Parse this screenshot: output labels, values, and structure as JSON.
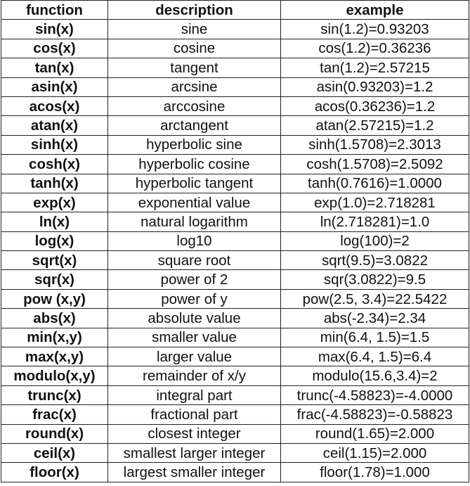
{
  "table": {
    "headers": [
      "function",
      "description",
      "example"
    ],
    "rows": [
      [
        "sin(x)",
        "sine",
        "sin(1.2)=0.93203"
      ],
      [
        "cos(x)",
        "cosine",
        "cos(1.2)=0.36236"
      ],
      [
        "tan(x)",
        "tangent",
        "tan(1.2)=2.57215"
      ],
      [
        "asin(x)",
        "arcsine",
        "asin(0.93203)=1.2"
      ],
      [
        "acos(x)",
        "arccosine",
        "acos(0.36236)=1.2"
      ],
      [
        "atan(x)",
        "arctangent",
        "atan(2.57215)=1.2"
      ],
      [
        "sinh(x)",
        "hyperbolic sine",
        "sinh(1.5708)=2.3013"
      ],
      [
        "cosh(x)",
        "hyperbolic cosine",
        "cosh(1.5708)=2.5092"
      ],
      [
        "tanh(x)",
        "hyperbolic tangent",
        "tanh(0.7616)=1.0000"
      ],
      [
        "exp(x)",
        "exponential value",
        "exp(1.0)=2.718281"
      ],
      [
        "ln(x)",
        "natural logarithm",
        "ln(2.718281)=1.0"
      ],
      [
        "log(x)",
        "log10",
        "log(100)=2"
      ],
      [
        "sqrt(x)",
        "square root",
        "sqrt(9.5)=3.0822"
      ],
      [
        "sqr(x)",
        "power of 2",
        "sqr(3.0822)=9.5"
      ],
      [
        "pow (x,y)",
        "power of y",
        "pow(2.5, 3.4)=22.5422"
      ],
      [
        "abs(x)",
        "absolute value",
        "abs(-2.34)=2.34"
      ],
      [
        "min(x,y)",
        "smaller value",
        "min(6.4, 1.5)=1.5"
      ],
      [
        "max(x,y)",
        "larger value",
        "max(6.4, 1.5)=6.4"
      ],
      [
        "modulo(x,y)",
        "remainder of x/y",
        "modulo(15.6,3.4)=2"
      ],
      [
        "trunc(x)",
        "integral part",
        "trunc(-4.58823)=-4.0000"
      ],
      [
        "frac(x)",
        "fractional part",
        "frac(-4.58823)=-0.58823"
      ],
      [
        "round(x)",
        "closest integer",
        "round(1.65)=2.000"
      ],
      [
        "ceil(x)",
        "smallest larger integer",
        "ceil(1.15)=2.000"
      ],
      [
        "floor(x)",
        "largest smaller integer",
        "floor(1.78)=1.000"
      ]
    ]
  }
}
